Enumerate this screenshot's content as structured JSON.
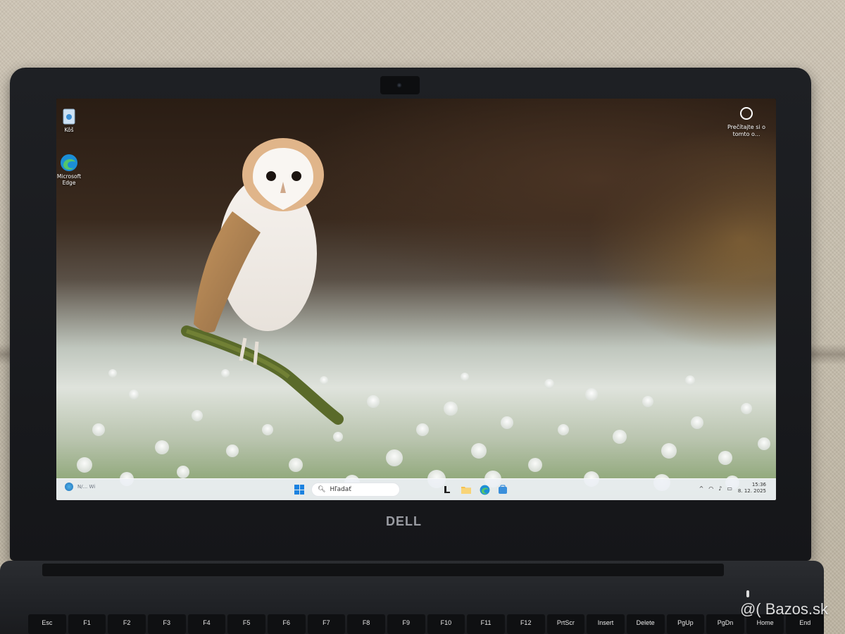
{
  "desktop": {
    "icons": [
      {
        "label": "Kôš",
        "icon": "recycle-bin-icon"
      },
      {
        "label": "Microsoft Edge",
        "icon": "edge-icon"
      }
    ],
    "spotlight_label": "Prečítajte si o tomto o..."
  },
  "taskbar": {
    "weather_text": "N/... Wi",
    "search_label": "Hľadať",
    "apps": [
      "file-explorer-icon",
      "folder-icon",
      "edge-icon",
      "store-icon"
    ],
    "tray_chevron": "^",
    "time": "15:36",
    "date": "8. 12. 2025"
  },
  "laptop": {
    "brand": "DELL",
    "keys": [
      "Esc",
      "F1",
      "F2",
      "F3",
      "F4",
      "F5",
      "F6",
      "F7",
      "F8",
      "F9",
      "F10",
      "F11",
      "F12",
      "PrtScr",
      "Insert",
      "Delete",
      "PgUp",
      "PgDn",
      "Home",
      "End"
    ]
  },
  "watermark": "@( Bazos.sk",
  "colors": {
    "accent": "#1c82e0",
    "bezel": "#1e2024"
  }
}
